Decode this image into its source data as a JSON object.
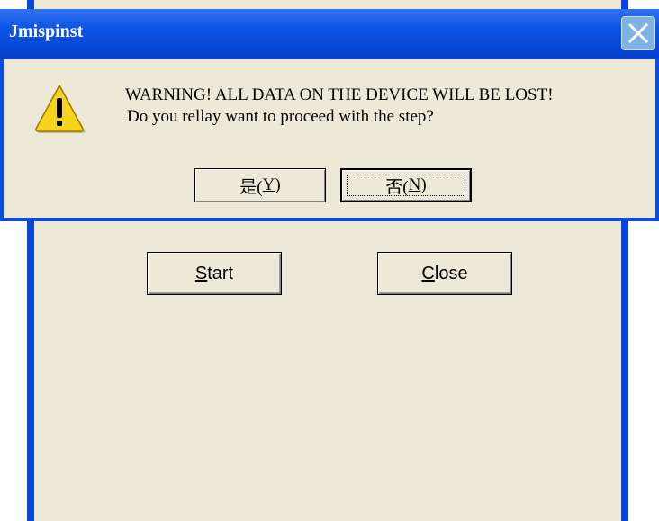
{
  "parent": {
    "start_label_accel": "S",
    "start_label_rest": "tart",
    "close_label_accel": "C",
    "close_label_rest": "lose"
  },
  "dialog": {
    "title": "Jmispinst",
    "message_line1": "WARNING! ALL DATA ON THE DEVICE WILL BE LOST!",
    "message_line2": "Do you rellay want to proceed with the step?",
    "yes_label": "是(",
    "yes_accel": "Y",
    "yes_end": ")",
    "no_label": "否(",
    "no_accel": "N",
    "no_end": ")"
  },
  "icons": {
    "warning": "warning-icon",
    "close": "close-icon"
  },
  "colors": {
    "titlebar": "#0c54e6",
    "face": "#ece9d8",
    "warning_yellow": "#f7d41c"
  }
}
